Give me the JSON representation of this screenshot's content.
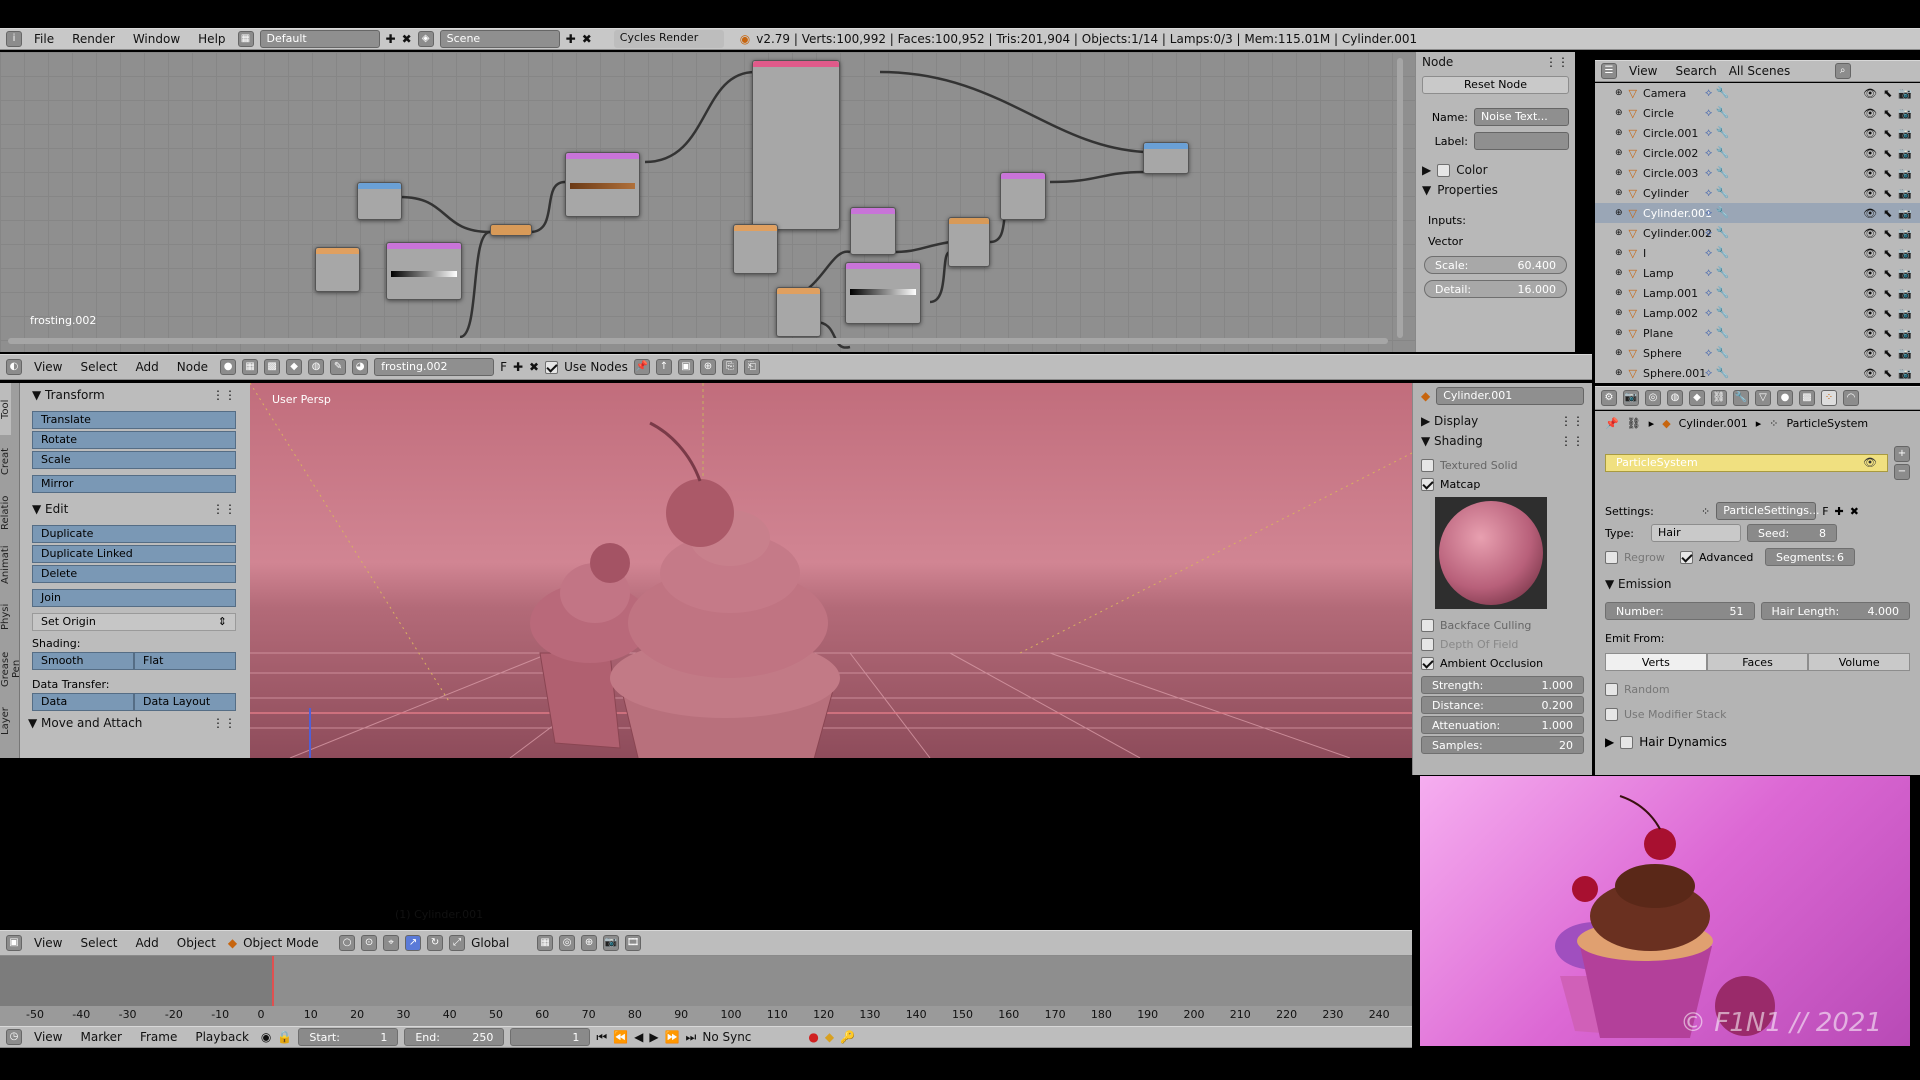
{
  "topbar": {
    "menus": [
      "File",
      "Render",
      "Window",
      "Help"
    ],
    "layout": "Default",
    "scene": "Scene",
    "engine": "Cycles Render",
    "stats": "v2.79 | Verts:100,992 | Faces:100,952 | Tris:201,904 | Objects:1/14 | Lamps:0/3 | Mem:115.01M | Cylinder.001"
  },
  "node_editor": {
    "material_label": "frosting.002",
    "header_menus": [
      "View",
      "Select",
      "Add",
      "Node"
    ],
    "material_field": "frosting.002",
    "fake_user": "F",
    "use_nodes": "Use Nodes"
  },
  "node_sidebar": {
    "title": "Node",
    "reset": "Reset Node",
    "name_label": "Name:",
    "name_value": "Noise Text...",
    "label_label": "Label:",
    "color": "Color",
    "properties": "Properties",
    "inputs": "Inputs:",
    "vector": "Vector",
    "scale_label": "Scale:",
    "scale_value": "60.400",
    "detail_label": "Detail:",
    "detail_value": "16.000"
  },
  "outliner": {
    "menus": [
      "View",
      "Search"
    ],
    "filter": "All Scenes",
    "items": [
      "Camera",
      "Circle",
      "Circle.001",
      "Circle.002",
      "Circle.003",
      "Cylinder",
      "Cylinder.001",
      "Cylinder.002",
      "I",
      "Lamp",
      "Lamp.001",
      "Lamp.002",
      "Plane",
      "Sphere",
      "Sphere.001"
    ],
    "selected": "Cylinder.001"
  },
  "toolshelf": {
    "tabs": [
      "Tool",
      "Creat",
      "Relatio",
      "Animati",
      "Physi",
      "Grease Pen",
      "Layer"
    ],
    "transform": "Transform",
    "transform_buttons": [
      "Translate",
      "Rotate",
      "Scale"
    ],
    "mirror": "Mirror",
    "edit": "Edit",
    "edit_buttons": [
      "Duplicate",
      "Duplicate Linked",
      "Delete"
    ],
    "join": "Join",
    "set_origin": "Set Origin",
    "shading": "Shading:",
    "smooth": "Smooth",
    "flat": "Flat",
    "data_transfer": "Data Transfer:",
    "data": "Data",
    "data_layout": "Data Layout",
    "move_attach": "Move and Attach"
  },
  "viewport": {
    "label": "User Persp",
    "object_label": "(1) Cylinder.001",
    "header_menus": [
      "View",
      "Select",
      "Add",
      "Object"
    ],
    "mode": "Object Mode",
    "orientation": "Global"
  },
  "view_props": {
    "object": "Cylinder.001",
    "display": "Display",
    "shading": "Shading",
    "textured_solid": "Textured Solid",
    "matcap": "Matcap",
    "backface": "Backface Culling",
    "depth_field": "Depth Of Field",
    "ao": "Ambient Occlusion",
    "strength_label": "Strength:",
    "strength_value": "1.000",
    "distance_label": "Distance:",
    "distance_value": "0.200",
    "attenuation_label": "Attenuation:",
    "attenuation_value": "1.000",
    "samples_label": "Samples:",
    "samples_value": "20"
  },
  "properties": {
    "breadcrumb_object": "Cylinder.001",
    "breadcrumb_system": "ParticleSystem",
    "particle_system": "ParticleSystem",
    "settings_label": "Settings:",
    "settings_value": "ParticleSettings...",
    "settings_f": "F",
    "type_label": "Type:",
    "type_value": "Hair",
    "seed_label": "Seed:",
    "seed_value": "8",
    "regrow": "Regrow",
    "advanced": "Advanced",
    "segments_label": "Segments:",
    "segments_value": "6",
    "emission": "Emission",
    "number_label": "Number:",
    "number_value": "51",
    "hair_length_label": "Hair Length:",
    "hair_length_value": "4.000",
    "emit_from": "Emit From:",
    "emit_tabs": [
      "Verts",
      "Faces",
      "Volume"
    ],
    "random": "Random",
    "modifier_stack": "Use Modifier Stack",
    "hair_dynamics": "Hair Dynamics"
  },
  "timeline": {
    "ticks": [
      "-50",
      "-40",
      "-30",
      "-20",
      "-10",
      "0",
      "10",
      "20",
      "30",
      "40",
      "50",
      "60",
      "70",
      "80",
      "90",
      "100",
      "110",
      "120",
      "130",
      "140",
      "150",
      "160",
      "170",
      "180",
      "190",
      "200",
      "210",
      "220",
      "230",
      "240"
    ],
    "menus": [
      "View",
      "Marker",
      "Frame",
      "Playback"
    ],
    "start_label": "Start:",
    "start_value": "1",
    "end_label": "End:",
    "end_value": "250",
    "current": "1",
    "sync": "No Sync"
  },
  "render_preview": {
    "copyright": "© F1N1 // 2021"
  },
  "colors": {
    "viewport_bg": "#b5616f",
    "render_bg": "#d86cd0",
    "accent": "#f0e080"
  }
}
